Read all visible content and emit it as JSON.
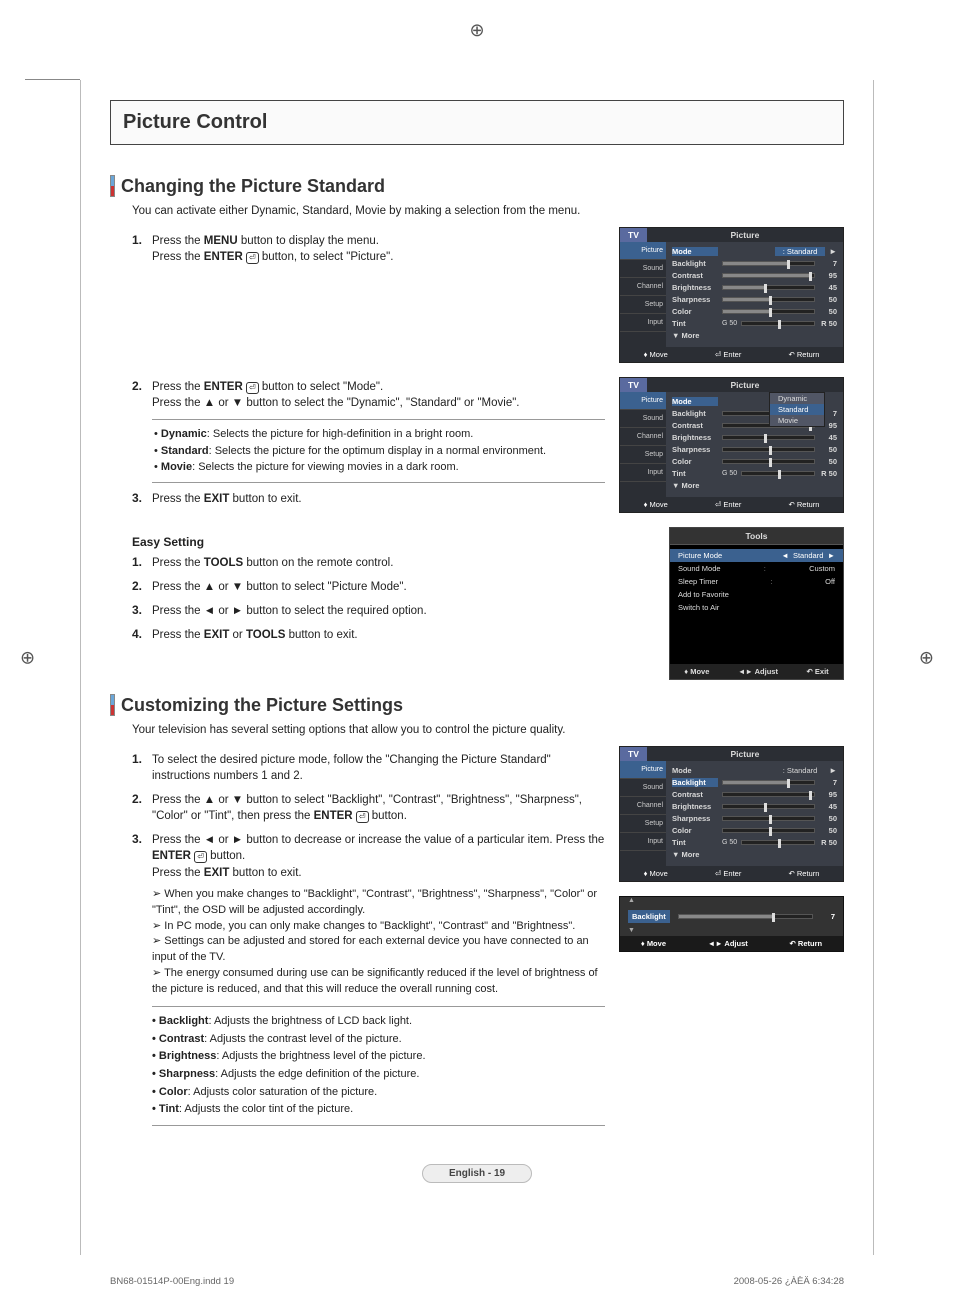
{
  "section_title": "Picture Control",
  "changing": {
    "heading": "Changing the Picture Standard",
    "intro": "You can activate either Dynamic, Standard, Movie by making a selection from the menu.",
    "step1a": "Press the ",
    "step1a_bold": "MENU",
    "step1a_end": " button to display the menu.",
    "step1b": "Press the ",
    "step1b_bold": "ENTER",
    "step1b_end": " button, to select \"Picture\".",
    "step2a": "Press the ",
    "step2a_bold": "ENTER",
    "step2a_end": " button to select \"Mode\".",
    "step2b": "Press the ▲ or ▼ button to select the \"Dynamic\", \"Standard\" or \"Movie\".",
    "note_dyn_b": "Dynamic",
    "note_dyn": ": Selects the picture for high-definition in a bright room.",
    "note_std_b": "Standard",
    "note_std": ": Selects the picture for the optimum display in a normal environment.",
    "note_mov_b": "Movie",
    "note_mov": ": Selects the picture for viewing movies in a dark room.",
    "step3": "Press the ",
    "step3_bold": "EXIT",
    "step3_end": " button to exit.",
    "easy_title": "Easy Setting",
    "easy1": "Press the ",
    "easy1_bold": "TOOLS",
    "easy1_end": " button on the remote control.",
    "easy2": "Press the ▲ or ▼ button to select \"Picture Mode\".",
    "easy3": "Press the ◄ or ► button to select the required option.",
    "easy4a": "Press the ",
    "easy4_bold1": "EXIT",
    "easy4_mid": " or ",
    "easy4_bold2": "TOOLS",
    "easy4_end": " button to exit."
  },
  "customizing": {
    "heading": "Customizing the Picture Settings",
    "intro": "Your television has several setting options that allow you to control the picture quality.",
    "step1": "To select the desired picture mode, follow the \"Changing the Picture Standard\" instructions numbers 1 and 2.",
    "step2a": "Press the ▲ or ▼ button to select \"Backlight\", \"Contrast\", \"Brightness\", \"Sharpness\", \"Color\" or \"Tint\", then press the ",
    "step2_bold": "ENTER",
    "step2_end": " button.",
    "step3a": "Press the ◄ or ► button to decrease or increase the value of a particular item. Press the ",
    "step3_bold": "ENTER",
    "step3_end": " button.",
    "step3_exit_a": "Press the ",
    "step3_exit_bold": "EXIT",
    "step3_exit_end": " button to exit.",
    "arrow1": "When you make changes to \"Backlight\", \"Contrast\", \"Brightness\", \"Sharpness\", \"Color\" or \"Tint\", the OSD will be adjusted accordingly.",
    "arrow2": "In PC mode, you can only make changes to \"Backlight\", \"Contrast\" and \"Brightness\".",
    "arrow3": "Settings can be adjusted and stored for each external device you have connected to an input of the TV.",
    "arrow4": "The energy consumed during use can be significantly reduced if the level of brightness of the picture is reduced, and that this will reduce the overall running cost.",
    "def_backlight_b": "Backlight",
    "def_backlight": ": Adjusts the brightness of LCD back light.",
    "def_contrast_b": "Contrast",
    "def_contrast": ": Adjusts the contrast level of the picture.",
    "def_brightness_b": "Brightness",
    "def_brightness": ": Adjusts the brightness level of the picture.",
    "def_sharpness_b": "Sharpness",
    "def_sharpness": ": Adjusts the edge definition of the picture.",
    "def_color_b": "Color",
    "def_color": ": Adjusts color saturation of the picture.",
    "def_tint_b": "Tint",
    "def_tint": ": Adjusts the color tint of the picture."
  },
  "osd": {
    "tv": "TV",
    "picture": "Picture",
    "side": [
      "Picture",
      "Sound",
      "Channel",
      "Setup",
      "Input"
    ],
    "rows": {
      "mode": "Mode",
      "mode_val": ": Standard",
      "backlight": "Backlight",
      "backlight_v": "7",
      "contrast": "Contrast",
      "contrast_v": "95",
      "brightness": "Brightness",
      "brightness_v": "45",
      "sharpness": "Sharpness",
      "sharpness_v": "50",
      "color": "Color",
      "color_v": "50",
      "tint": "Tint",
      "tint_l": "G 50",
      "tint_r": "R 50",
      "more": "▼ More"
    },
    "dropdown": [
      "Dynamic",
      "Standard",
      "Movie"
    ],
    "dropdown_contrast_v": "95",
    "foot_move": "Move",
    "foot_enter": "Enter",
    "foot_return": "Return",
    "foot_adjust": "Adjust",
    "foot_exit": "Exit"
  },
  "tools": {
    "title": "Tools",
    "rows": [
      {
        "l": "Picture Mode",
        "r": "Standard",
        "sel": true
      },
      {
        "l": "Sound Mode",
        "r": "Custom"
      },
      {
        "l": "Sleep Timer",
        "r": "Off"
      },
      {
        "l": "Add to Favorite",
        "r": ""
      },
      {
        "l": "Switch to Air",
        "r": ""
      }
    ]
  },
  "bl_strip": {
    "label": "Backlight",
    "value": "7"
  },
  "page_footer_center": "English - 19",
  "footer_left": "BN68-01514P-00Eng.indd   19",
  "footer_right": "2008-05-26   ¿ÀÈÄ 6:34:28"
}
